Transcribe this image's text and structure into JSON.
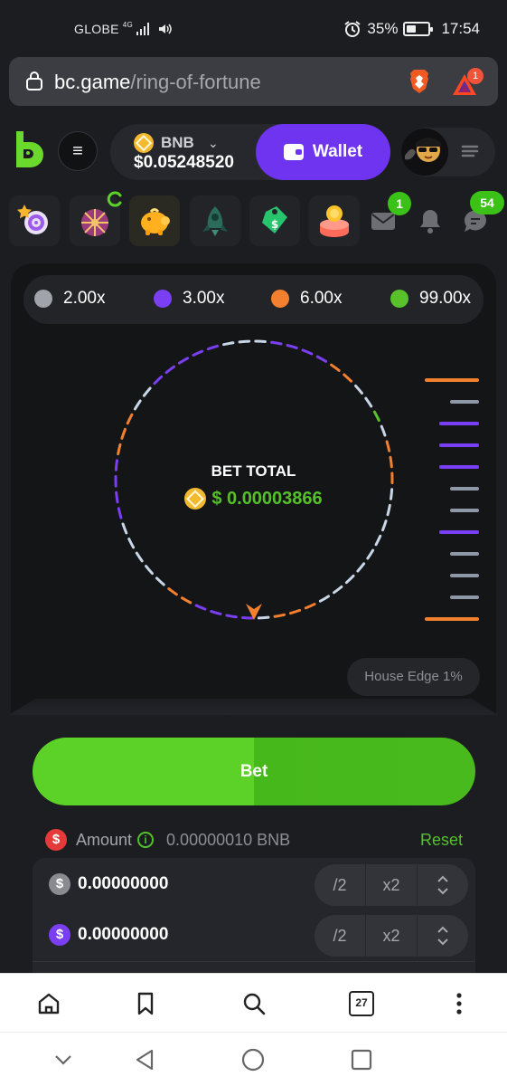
{
  "status_bar": {
    "carrier": "GLOBE",
    "network": "4G",
    "battery": "35%",
    "battery_level": 0.35,
    "time": "17:54"
  },
  "browser": {
    "url_host": "bc.game",
    "url_path": "/ring-of-fortune",
    "rewards_badge": "1",
    "tabs_count": "27"
  },
  "header": {
    "currency": "BNB",
    "balance": "$0.05248520",
    "wallet_label": "Wallet"
  },
  "icons_row": {
    "mail_badge": "1",
    "chat_badge": "54"
  },
  "multipliers": [
    {
      "label": "2.00x",
      "color": "#a0a3aa"
    },
    {
      "label": "3.00x",
      "color": "#7a3ff2"
    },
    {
      "label": "6.00x",
      "color": "#f2802e"
    },
    {
      "label": "99.00x",
      "color": "#59c22a"
    }
  ],
  "game": {
    "bet_total_label": "BET TOTAL",
    "bet_total_value": "$ 0.00003866",
    "house_edge": "House Edge 1%",
    "history": [
      "orange",
      "gray",
      "purple",
      "purple",
      "purple",
      "gray",
      "gray",
      "purple",
      "gray",
      "gray",
      "gray",
      "orange"
    ]
  },
  "bet": {
    "bet_button": "Bet",
    "amount_label": "Amount",
    "min_amount": "0.00000010 BNB",
    "reset_label": "Reset",
    "rows": [
      {
        "value": "0.00000000",
        "half": "/2",
        "double": "x2",
        "color": "#8a8b91"
      },
      {
        "value": "0.00000000",
        "half": "/2",
        "double": "x2",
        "color": "#7a3ff2"
      }
    ]
  },
  "colors": {
    "accent_green": "#55c12a",
    "wallet_purple": "#6f34f0",
    "segment_gray": "#c8d6e6",
    "segment_purple": "#7a3ff2",
    "segment_orange": "#f2802e",
    "segment_green": "#59c22a"
  }
}
